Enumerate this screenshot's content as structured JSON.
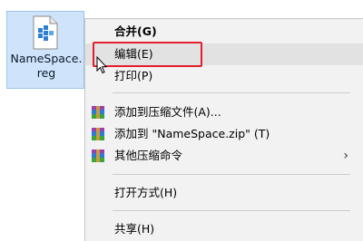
{
  "file": {
    "label": "NameSpace.reg",
    "icon": "registry-file-icon"
  },
  "context_menu": {
    "items": [
      {
        "label": "合并(G)",
        "bold": true
      },
      {
        "label": "编辑(E)",
        "highlighted": true
      },
      {
        "label": "打印(P)"
      },
      {
        "label": "添加到压缩文件(A)...",
        "icon": "winrar-icon"
      },
      {
        "label": "添加到 \"NameSpace.zip\" (T)",
        "icon": "winrar-icon"
      },
      {
        "label": "其他压缩命令",
        "icon": "winrar-icon",
        "submenu": true
      },
      {
        "label": "打开方式(H)"
      },
      {
        "label": "共享(H)"
      }
    ],
    "submenu_arrow": "chevron-right-icon"
  },
  "annotation": {
    "highlight_color": "#e3202e"
  }
}
